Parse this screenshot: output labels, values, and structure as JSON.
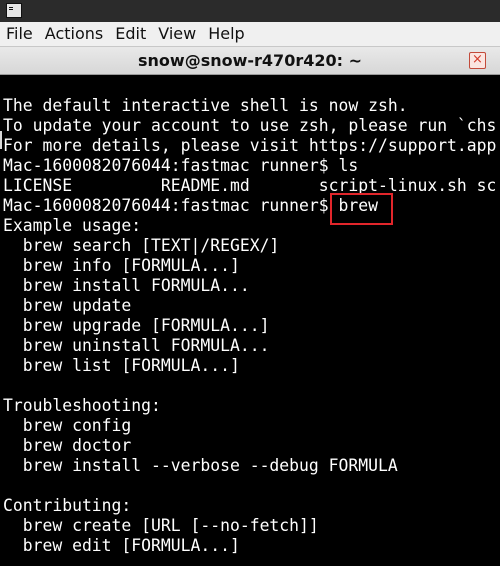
{
  "window": {
    "title": "snow@snow-r470r420: ~",
    "close_label": "×"
  },
  "menubar": {
    "items": [
      "File",
      "Actions",
      "Edit",
      "View",
      "Help"
    ]
  },
  "terminal": {
    "lines": [
      "The default interactive shell is now zsh.",
      "To update your account to use zsh, please run `chs",
      "For more details, please visit https://support.app",
      "Mac-1600082076044:fastmac runner$ ls",
      "LICENSE         README.md       script-linux.sh sc",
      "Mac-1600082076044:fastmac runner$ brew",
      "Example usage:",
      "  brew search [TEXT|/REGEX/]",
      "  brew info [FORMULA...]",
      "  brew install FORMULA...",
      "  brew update",
      "  brew upgrade [FORMULA...]",
      "  brew uninstall FORMULA...",
      "  brew list [FORMULA...]",
      "",
      "Troubleshooting:",
      "  brew config",
      "  brew doctor",
      "  brew install --verbose --debug FORMULA",
      "",
      "Contributing:",
      "  brew create [URL [--no-fetch]]",
      "  brew edit [FORMULA...]"
    ],
    "highlighted_command": "brew"
  },
  "colors": {
    "terminal_bg": "#000000",
    "terminal_fg": "#ffffff",
    "highlight": "#e2262b"
  }
}
